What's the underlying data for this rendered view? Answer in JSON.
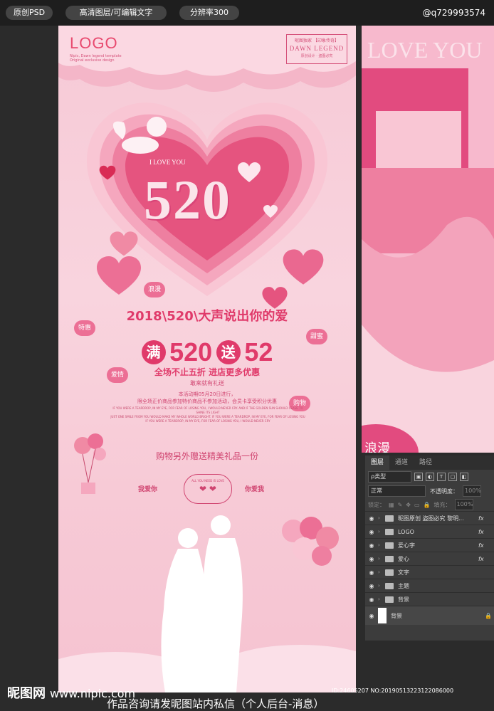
{
  "topbar": {
    "pill1": "原创PSD",
    "pill2": "高清图层/可编辑文字",
    "pill3": "分辨率300",
    "contact": "@q729993574"
  },
  "poster": {
    "logo": "LOGO",
    "logo_sub": "Nipic, Dawn legend template Original exclusive design",
    "brand_top": "昵图独家 【印象传奇】",
    "brand_mid": "DAWN LEGEND",
    "brand_bot": "原创设计 · 盗图必究",
    "iloveyou": "I LOVE YOU",
    "title": "520",
    "slogan": "2018\\520\\大声说出你的爱",
    "promo_man": "满",
    "promo_520": "520",
    "promo_song": "送",
    "promo_52": "52",
    "sub1": "全场不止五折 进店更多优惠",
    "sub2": "敢来就有礼送",
    "line1": "本活动期05月20日进行，",
    "line2": "限全场正价商品参加特价商品不参加活动，会员卡享受积分优惠",
    "eng1": "IF YOU WERE A TEARDROP, IN MY EYE, FOR FEAR OF LOSING YOU, I WOULD NEVER CRY. AND IF THE GOLDEN SUN SHOULD CEASE TO SHINE ITS LIGHT",
    "eng2": "JUST ONE SMILE FROM YOU WOULD MAKE MY WHOLE WORLD BRIGHT. IF YOU WERE A TEARDROP, IN MY EYE, FOR FEAR OF LOSING YOU",
    "eng3": "IF YOU WERE A TEARDROP, IN MY EYE, FOR FEAR OF LOSING YOU, I WOULD NEVER CRY",
    "gift": "购物另外赠送精美礼品一份",
    "love_left": "我爱你",
    "love_right": "你爱我",
    "badge": "ALL YOU NEED IS LOVE",
    "tags": [
      "浪漫",
      "特惠",
      "甜蜜",
      "爱情",
      "购物"
    ]
  },
  "preview": {
    "text": "LOVE YOU",
    "bottom_text": "浪漫"
  },
  "panel": {
    "tabs": [
      "图层",
      "通道",
      "路径"
    ],
    "kind": "ρ类型",
    "blend": "正常",
    "opacity_label": "不透明度：",
    "opacity_value": "100%",
    "lock_label": "锁定：",
    "fill_label": "填充：",
    "fill_value": "100%",
    "layers": [
      {
        "name": "昵图原创 盗图必究 黎明...",
        "fx": "fx"
      },
      {
        "name": "LOGO",
        "fx": "fx"
      },
      {
        "name": "爱心字",
        "fx": "fx"
      },
      {
        "name": "爱心",
        "fx": "fx"
      },
      {
        "name": "文字",
        "fx": ""
      },
      {
        "name": "主题",
        "fx": ""
      },
      {
        "name": "背景",
        "fx": ""
      }
    ],
    "bg_layer": "背景"
  },
  "footer": {
    "site": "昵图网",
    "url": "www.nipic.com",
    "id_line": "ID:24605207 NO:20190513223122086000",
    "bottom": "作品咨询请发昵图站内私信（个人后台-消息）"
  },
  "colors": {
    "accent": "#e03a6a",
    "poster_bg": "#f7cad6",
    "dark_bg": "#2b2b2b"
  }
}
